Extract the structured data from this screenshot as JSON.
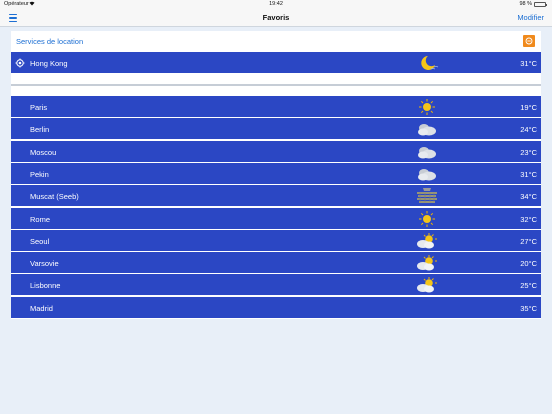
{
  "status_bar": {
    "carrier": "Opérateur",
    "time": "19:42",
    "battery": "98 %",
    "battery_level": 0.98
  },
  "nav": {
    "title": "Favoris",
    "edit_label": "Modifier",
    "menu_icon": "hamburger-menu-icon"
  },
  "location_services": {
    "label": "Services de location",
    "toggle_icon": "location-toggle-icon",
    "toggle_color": "#f08a1c"
  },
  "current_location": {
    "city": "Hong Kong",
    "temp": "31°C",
    "icon": "moon-night-icon"
  },
  "favorites": [
    {
      "city": "Paris",
      "temp": "19°C",
      "icon": "sun-icon"
    },
    {
      "city": "Berlin",
      "temp": "24°C",
      "icon": "cloud-icon"
    },
    {
      "city": "Moscou",
      "temp": "23°C",
      "icon": "cloud-icon"
    },
    {
      "city": "Pekin",
      "temp": "31°C",
      "icon": "cloud-icon"
    },
    {
      "city": "Muscat (Seeb)",
      "temp": "34°C",
      "icon": "haze-icon"
    },
    {
      "city": "Rome",
      "temp": "32°C",
      "icon": "sun-icon"
    },
    {
      "city": "Seoul",
      "temp": "27°C",
      "icon": "partly-cloudy-icon"
    },
    {
      "city": "Varsovie",
      "temp": "20°C",
      "icon": "partly-cloudy-icon"
    },
    {
      "city": "Lisbonne",
      "temp": "25°C",
      "icon": "partly-cloudy-icon"
    },
    {
      "city": "Madrid",
      "temp": "35°C",
      "icon": ""
    }
  ],
  "colors": {
    "accent": "#1d6fd3",
    "row_background": "#2b47c4",
    "page_background": "#e8eff8"
  }
}
